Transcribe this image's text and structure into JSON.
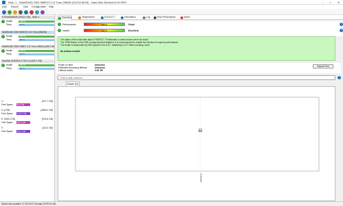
{
  "window": {
    "title": "Disk: 1 - SAMSUNG SSD 980EVO 2.5 7mm 256GB (S1234 5678) - Hard Disk Sentinel 6.00 PRO",
    "minimize": "–",
    "maximize": "□",
    "close": "✕"
  },
  "menu": [
    "Disk",
    "Report",
    "Disk",
    "Configuration",
    "Help"
  ],
  "disks": [
    {
      "header": "ST2000DM008 (2000.4 GB) - Disk: 0",
      "health_label": "Health",
      "health_value": "100 %",
      "temp_label": "Temp",
      "temp_value": "43 °C"
    },
    {
      "header": "SAMSUNG SSD 980EVO 2.5 7mm (256GB)",
      "health_label": "Health",
      "health_value": "100 %",
      "temp_label": "Temp",
      "temp_value": "38 °C"
    },
    {
      "header": "SAMSUNG SSD PM871 2.5 7mm 128GB (128.0 GB)",
      "health_label": "Health",
      "health_value": "100 %",
      "temp_label": "Temp",
      "temp_value": "35 °C"
    },
    {
      "header": "SanDisk SDSSDA-1T00-G (1000.2 GB)",
      "health_label": "Health",
      "health_value": "100 %",
      "temp_label": "Temp",
      "temp_value": "33 °C"
    }
  ],
  "drives": [
    {
      "name": "C:",
      "size": "(237.7 GB)",
      "free_label": "Free Space",
      "free_value": "52.3 GB"
    },
    {
      "name": "D: (2TB)",
      "size": "(1863.0 GB)",
      "free_label": "Free Space",
      "free_value": "1270.3 GB"
    },
    {
      "name": "E: (SSD 1TB)",
      "size": "(976.6 GB)",
      "free_label": "Free Space",
      "free_value": "451.4 GB"
    },
    {
      "name": "F:",
      "size": "(119.2 GB)",
      "free_label": "Free Space",
      "free_value": "106.7 GB"
    }
  ],
  "tabs": [
    {
      "label": "Overview",
      "color": "#2c9e3b"
    },
    {
      "label": "Temperature",
      "color": "#e07b1a"
    },
    {
      "label": "S.M.A.R.T.",
      "color": "#1f6fb5"
    },
    {
      "label": "Information",
      "color": "#1f6fb5"
    },
    {
      "label": "Log",
      "color": "#777777"
    },
    {
      "label": "Disk Performance",
      "color": "#444444"
    },
    {
      "label": "Alerts",
      "color": "#d33"
    }
  ],
  "performance": {
    "label": "Performance:",
    "percent": "100 %",
    "word": "Good"
  },
  "health": {
    "label": "Health:",
    "percent": "100 %",
    "word": "Excellent"
  },
  "status_text": {
    "line1": "The status of the solid state disk is PERFECT. Problematic or weak sectors were not found.",
    "line2": "The TRIM feature of the SSD is supported but disabled. It is recommended to enable the function to improve performance.",
    "line3": "The health is determined by SSD specific S.M.A.R.T. attribute(s): #177 Wear Leveling Count",
    "bold": "No actions needed."
  },
  "info": {
    "power_on_label": "Power on time:",
    "power_on_value": "Unknown",
    "remaining_label": "Estimated remaining lifetime:",
    "remaining_value": "Unknown",
    "writes_label": "Lifetime writes:",
    "writes_value": "0.82 TB",
    "reset_button": "Repeat Test"
  },
  "comment_placeholder": "Click to add comment ...",
  "chart_tab": "Health (%)",
  "chart_data": {
    "type": "scatter",
    "x": [
      "07.05.2024"
    ],
    "y": [
      100
    ],
    "point_label": "100",
    "x_tick_label": "07.05.2024",
    "grid": true
  },
  "statusbar": "Status last updated: 07.05.2024 Tuesday 09:09:01 AM"
}
